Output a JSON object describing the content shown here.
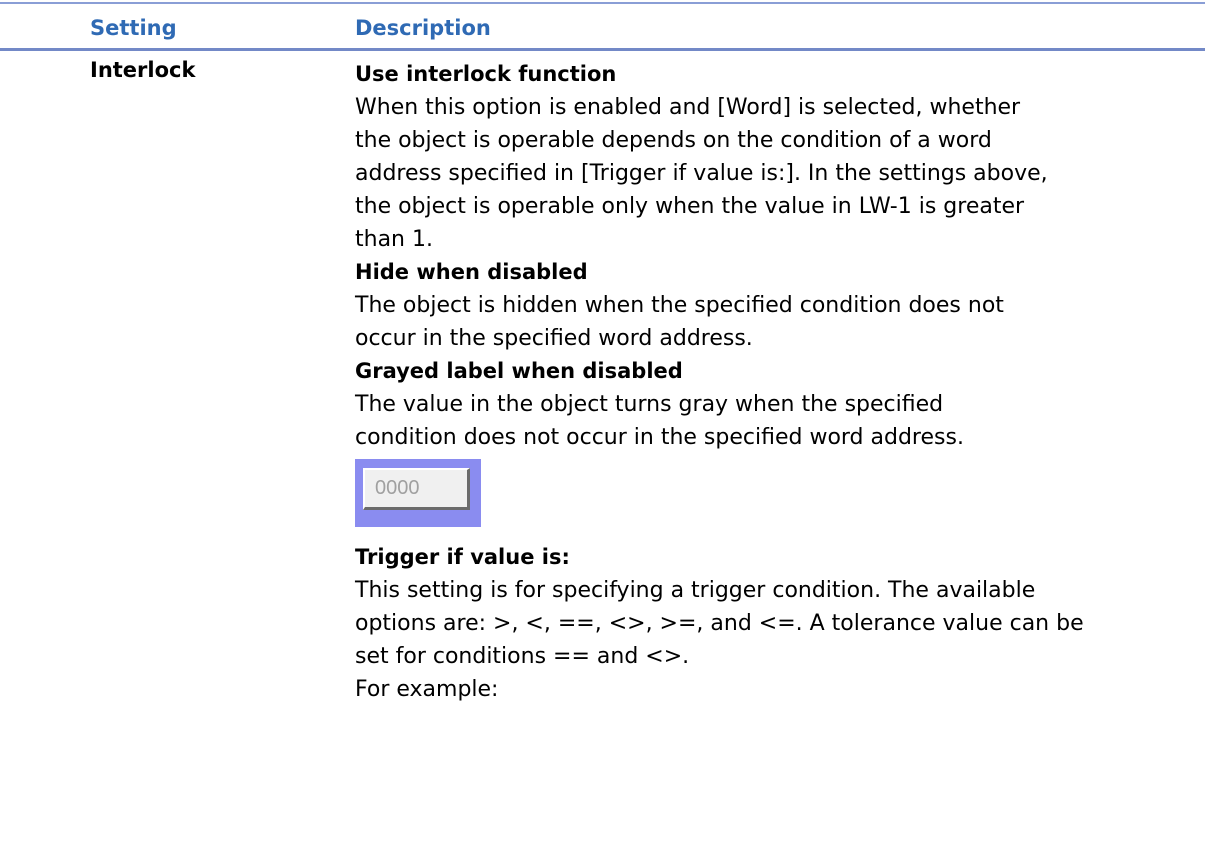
{
  "table": {
    "header": {
      "setting": "Setting",
      "description": "Description"
    },
    "row": {
      "setting": "Interlock",
      "items": [
        {
          "title": "Use interlock function",
          "text": "When this option is enabled and [Word] is selected, whether\nthe object is operable depends on the condition of a word\naddress specified in [Trigger if value is:]. In the settings above,\nthe object is operable only when the value in LW-1 is greater\nthan 1."
        },
        {
          "title": "Hide when disabled",
          "text": "The object is hidden when the specified condition does not\noccur in the specified word address."
        },
        {
          "title": "Grayed label when disabled",
          "text": "The value in the object turns gray when the specified\ncondition does not occur in the specified word address."
        },
        {
          "title": "Trigger if value is:",
          "text": "This setting is for specifying a trigger condition. The available\noptions are: >, <, ==, <>, >=, and <=. A tolerance value can be\nset for conditions == and <>.\nFor example:"
        }
      ],
      "demo_value": "0000"
    }
  },
  "colors": {
    "header_text": "#2f6ab4",
    "rule": "#7389c7",
    "demo_frame": "#8a8cf0",
    "demo_text": "#a0a0a0"
  }
}
